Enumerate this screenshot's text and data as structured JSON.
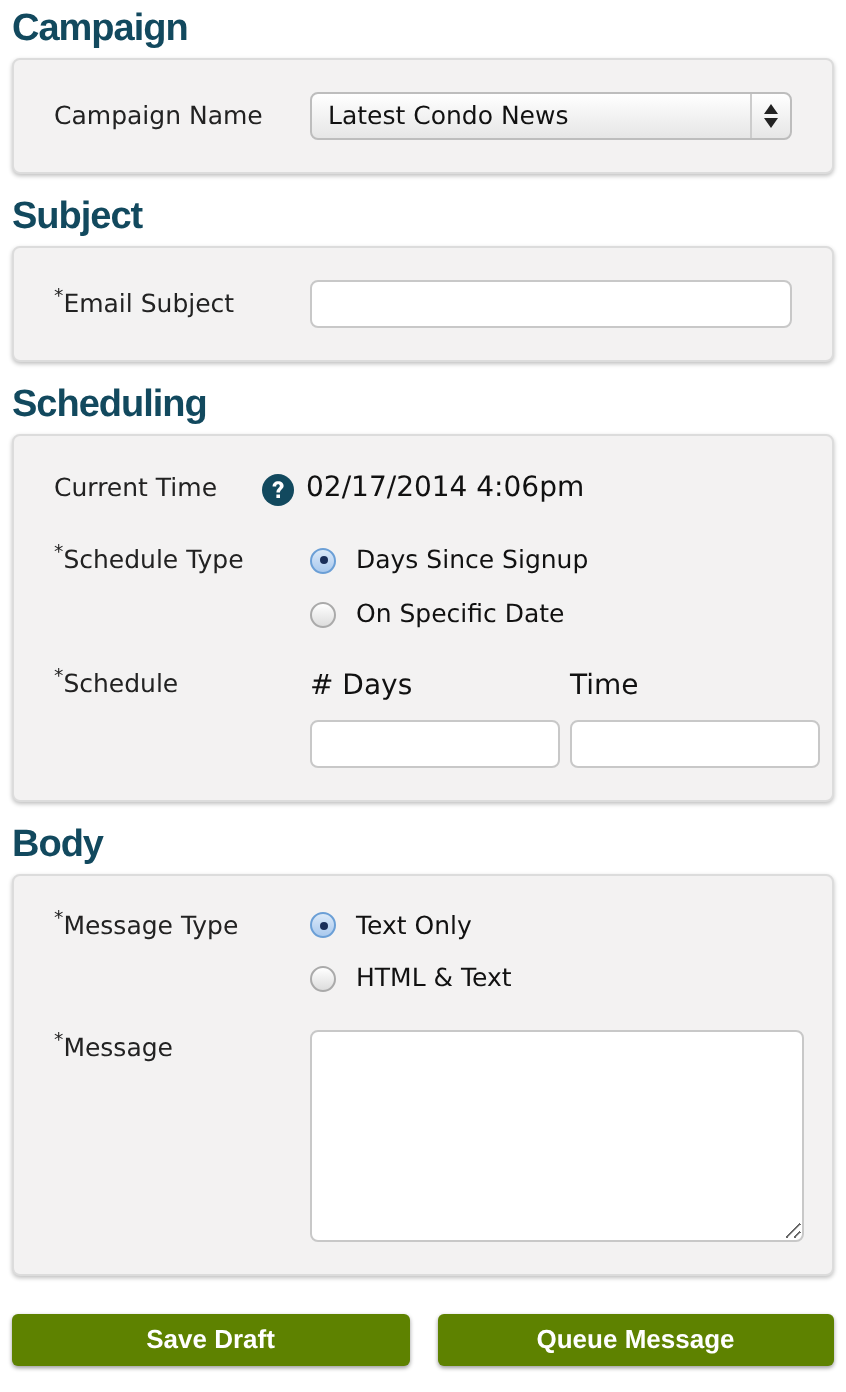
{
  "sections": [
    {
      "title": "Campaign",
      "rows": [
        {
          "kind": "select",
          "label": "Campaign Name",
          "value": "Latest Condo News"
        }
      ]
    },
    {
      "title": "Subject",
      "rows": [
        {
          "kind": "text",
          "label": "$^{*}$Email Subject"
        }
      ]
    },
    {
      "title": "Scheduling",
      "rows": [
        {
          "kind": "info",
          "label": "Current Time",
          "value": "02/17/2014 4:06pm"
        },
        {
          "kind": "radio",
          "label": "$^{*}$Schedule Type",
          "options": [
            {
              "label": "Days Since Signup",
              "selected": true
            },
            {
              "label": "On Specific Date",
              "selected": false
            }
          ]
        },
        {
          "kind": "pair",
          "label": "$^{*}$Schedule",
          "fields": [
            {
              "label": "# Days"
            },
            {
              "label": "Time"
            }
          ]
        }
      ]
    },
    {
      "title": "Body",
      "rows": [
        {
          "kind": "radio",
          "label": "$^{*}$Message Type",
          "options": [
            {
              "label": "Text Only",
              "selected": true
            },
            {
              "label": "HTML & Text",
              "selected": false
            }
          ]
        },
        {
          "kind": "textarea",
          "label": "$^{*}$Message"
        }
      ]
    }
  ],
  "buttons": [
    "Save Draft",
    "Queue Message"
  ]
}
